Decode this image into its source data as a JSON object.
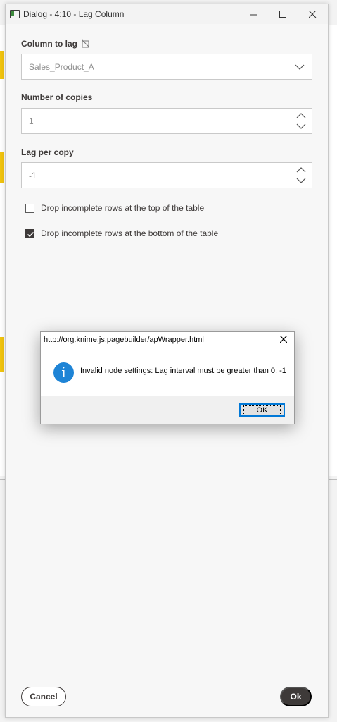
{
  "window": {
    "title": "Dialog - 4:10 - Lag Column",
    "controls": [
      "minimize",
      "maximize",
      "close"
    ]
  },
  "form": {
    "column_to_lag": {
      "label": "Column to lag",
      "value": "Sales_Product_A"
    },
    "number_of_copies": {
      "label": "Number of copies",
      "value": "1"
    },
    "lag_per_copy": {
      "label": "Lag per copy",
      "value": "-1"
    },
    "drop_top": {
      "label": "Drop incomplete rows at the top of the table",
      "checked": false
    },
    "drop_bottom": {
      "label": "Drop incomplete rows at the bottom of the table",
      "checked": true
    }
  },
  "footer": {
    "cancel_label": "Cancel",
    "ok_label": "Ok"
  },
  "alert": {
    "title": "http://org.knime.js.pagebuilder/apWrapper.html",
    "message": "Invalid node settings: Lag interval must be greater than 0: -1",
    "ok_label": "OK",
    "icon": "info-icon"
  },
  "colors": {
    "primary_dark": "#3e3a39",
    "info_blue": "#1e84d6",
    "focus_blue": "#0078d7"
  }
}
